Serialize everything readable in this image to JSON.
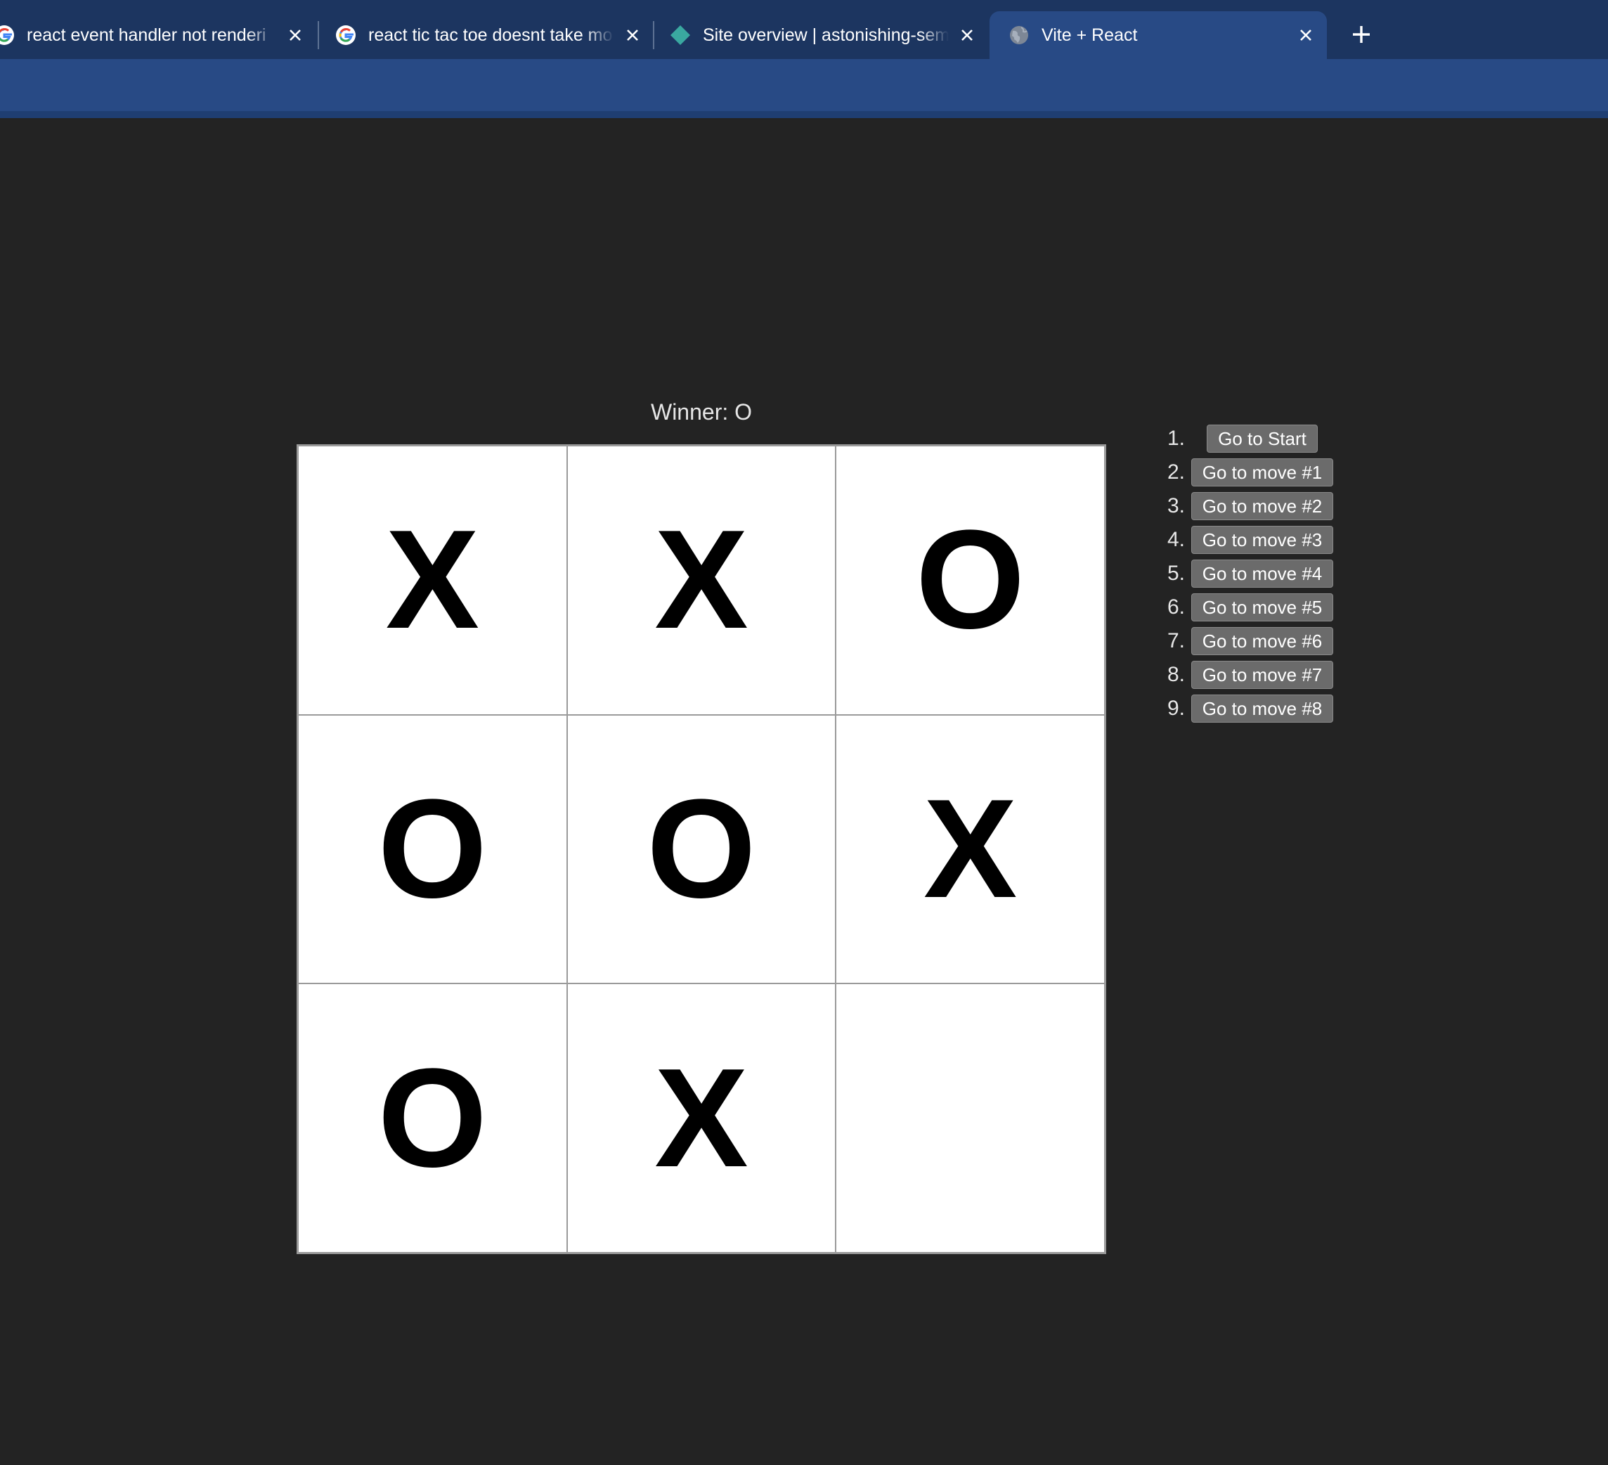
{
  "tabs": [
    {
      "title": "react event handler not renderi",
      "favicon": "google-icon",
      "active": false
    },
    {
      "title": "react tic tac toe doesnt take mo",
      "favicon": "google-icon",
      "active": false
    },
    {
      "title": "Site overview | astonishing-sem",
      "favicon": "netlify-diamond-icon",
      "active": false
    },
    {
      "title": "Vite + React",
      "favicon": "globe-icon",
      "active": true
    }
  ],
  "colors": {
    "tab_strip": "#1c3560",
    "active_tab": "#284a85",
    "page_background": "#232323",
    "history_button": "#6b6b6b"
  },
  "game": {
    "status": "Winner: O",
    "squares": [
      "X",
      "X",
      "O",
      "O",
      "O",
      "X",
      "O",
      "X",
      ""
    ]
  },
  "history": [
    {
      "number": "1.",
      "label": "Go to Start"
    },
    {
      "number": "2.",
      "label": "Go to move #1"
    },
    {
      "number": "3.",
      "label": "Go to move #2"
    },
    {
      "number": "4.",
      "label": "Go to move #3"
    },
    {
      "number": "5.",
      "label": "Go to move #4"
    },
    {
      "number": "6.",
      "label": "Go to move #5"
    },
    {
      "number": "7.",
      "label": "Go to move #6"
    },
    {
      "number": "8.",
      "label": "Go to move #7"
    },
    {
      "number": "9.",
      "label": "Go to move #8"
    }
  ]
}
